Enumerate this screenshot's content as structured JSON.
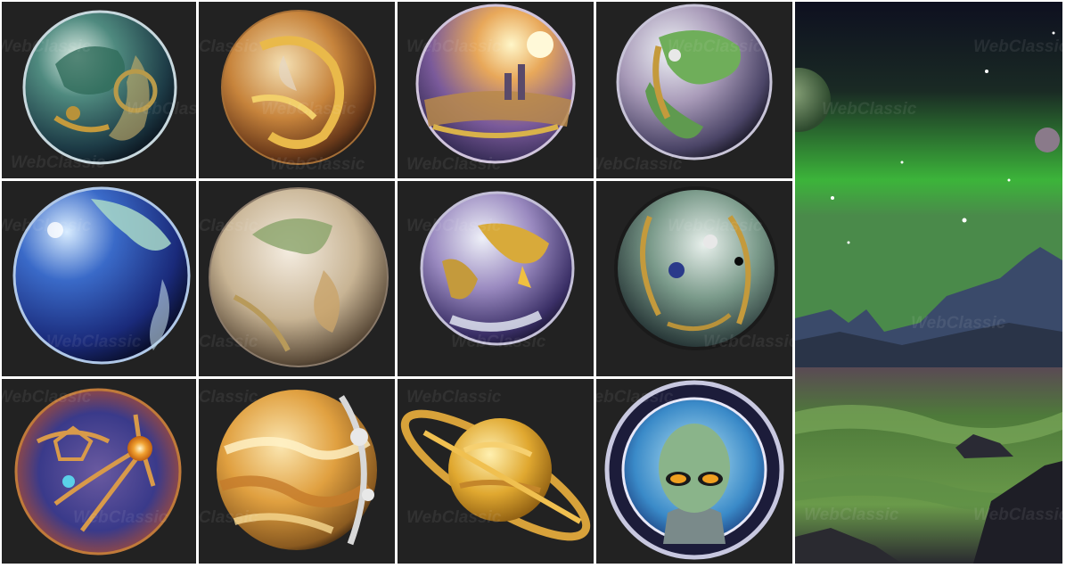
{
  "watermark": {
    "text": "WebClassic"
  },
  "gallery": {
    "tiles": [
      {
        "name": "planet-teal-gears",
        "icon": "planet-icon"
      },
      {
        "name": "planet-amber-swirl",
        "icon": "planet-icon"
      },
      {
        "name": "planet-sunset-city",
        "icon": "planet-icon"
      },
      {
        "name": "planet-green-continents",
        "icon": "planet-icon"
      },
      {
        "name": "planet-blue-ocean",
        "icon": "planet-icon"
      },
      {
        "name": "planet-pastel-earth",
        "icon": "planet-icon"
      },
      {
        "name": "planet-purple-gold",
        "icon": "planet-icon"
      },
      {
        "name": "planet-mech-green",
        "icon": "planet-icon"
      },
      {
        "name": "planet-cracked-orb",
        "icon": "planet-icon"
      },
      {
        "name": "planet-gas-giant",
        "icon": "planet-icon"
      },
      {
        "name": "planet-ringed",
        "icon": "ringed-planet-icon"
      },
      {
        "name": "alien-emblem",
        "icon": "alien-badge-icon"
      }
    ],
    "colors": {
      "tile_bg": "#222222",
      "separator": "#ffffff",
      "nebula_green": "#3cb43a",
      "ground_green": "#4e7a3a"
    }
  }
}
